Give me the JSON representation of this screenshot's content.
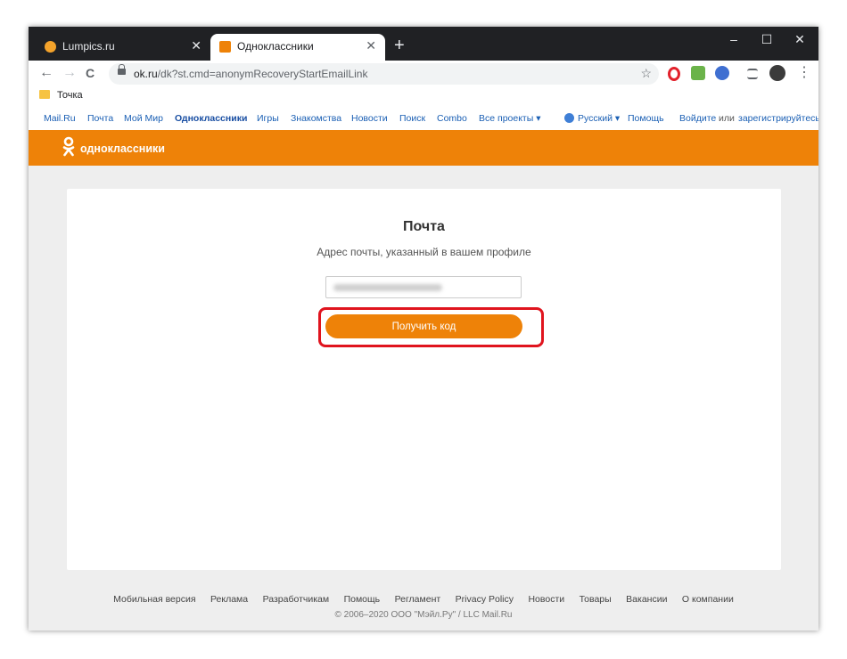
{
  "browser": {
    "tabs": [
      {
        "title": "Lumpics.ru",
        "favicon_color": "#f4a32b",
        "active": false
      },
      {
        "title": "Одноклассники",
        "favicon_color": "#ee8208",
        "active": true
      }
    ],
    "new_tab": "+",
    "window_controls": {
      "minimize": "–",
      "maximize": "☐",
      "close": "✕"
    },
    "nav": {
      "back": "←",
      "forward": "→",
      "reload": "C"
    },
    "address": {
      "domain": "ok.ru",
      "path": "/dk?st.cmd=anonymRecoveryStartEmailLink"
    },
    "bookmark_star": "☆",
    "bookmarks": [
      {
        "label": "Точка"
      }
    ],
    "menu_icon": "⋮"
  },
  "portal_nav": {
    "items": [
      "Mail.Ru",
      "Почта",
      "Мой Мир",
      "Одноклассники",
      "Игры",
      "Знакомства",
      "Новости",
      "Поиск",
      "Combo",
      "Все проекты ▾"
    ],
    "lang": "Русский ▾",
    "help": "Помощь",
    "login": "Войдите",
    "or": "или",
    "register": "зарегистрируйтесь"
  },
  "header": {
    "logo_text": "одноклассники",
    "brand_color": "#ee8208"
  },
  "form": {
    "title": "Почта",
    "subtitle": "Адрес почты, указанный в вашем профиле",
    "submit_label": "Получить код"
  },
  "footer": {
    "links": [
      "Мобильная версия",
      "Реклама",
      "Разработчикам",
      "Помощь",
      "Регламент",
      "Privacy Policy",
      "Новости",
      "Товары",
      "Вакансии",
      "О компании"
    ],
    "copyright": "© 2006–2020 ООО \"Мэйл.Ру\" / LLC Mail.Ru"
  }
}
